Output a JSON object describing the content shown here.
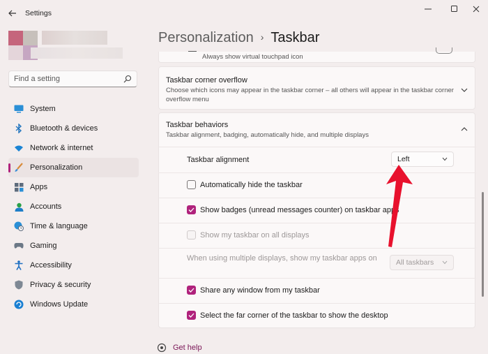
{
  "window": {
    "title": "Settings",
    "back_icon": "back-arrow-icon",
    "controls": [
      "minimize-icon",
      "maximize-icon",
      "close-icon"
    ]
  },
  "search": {
    "placeholder": "Find a setting",
    "icon": "search-icon"
  },
  "sidebar": {
    "items": [
      {
        "label": "System",
        "icon": "monitor-icon",
        "selected": false
      },
      {
        "label": "Bluetooth & devices",
        "icon": "bluetooth-icon",
        "selected": false
      },
      {
        "label": "Network & internet",
        "icon": "wifi-icon",
        "selected": false
      },
      {
        "label": "Personalization",
        "icon": "brush-icon",
        "selected": true
      },
      {
        "label": "Apps",
        "icon": "apps-icon",
        "selected": false
      },
      {
        "label": "Accounts",
        "icon": "person-icon",
        "selected": false
      },
      {
        "label": "Time & language",
        "icon": "globe-clock-icon",
        "selected": false
      },
      {
        "label": "Gaming",
        "icon": "gamepad-icon",
        "selected": false
      },
      {
        "label": "Accessibility",
        "icon": "accessibility-icon",
        "selected": false
      },
      {
        "label": "Privacy & security",
        "icon": "shield-icon",
        "selected": false
      },
      {
        "label": "Windows Update",
        "icon": "update-icon",
        "selected": false
      }
    ]
  },
  "breadcrumb": {
    "parent": "Personalization",
    "separator": "›",
    "current": "Taskbar"
  },
  "touchpad_row": {
    "subtitle": "Always show virtual touchpad icon"
  },
  "corner_overflow": {
    "title": "Taskbar corner overflow",
    "subtitle": "Choose which icons may appear in the taskbar corner – all others will appear in the taskbar corner overflow menu"
  },
  "behaviors": {
    "title": "Taskbar behaviors",
    "subtitle": "Taskbar alignment, badging, automatically hide, and multiple displays",
    "alignment": {
      "label": "Taskbar alignment",
      "value": "Left"
    },
    "options": [
      {
        "label": "Automatically hide the taskbar",
        "checked": false,
        "disabled": false
      },
      {
        "label": "Show badges (unread messages counter) on taskbar apps",
        "checked": true,
        "disabled": false
      },
      {
        "label": "Show my taskbar on all displays",
        "checked": false,
        "disabled": true
      }
    ],
    "multi_display": {
      "label": "When using multiple displays, show my taskbar apps on",
      "value": "All taskbars",
      "disabled": true
    },
    "options2": [
      {
        "label": "Share any window from my taskbar",
        "checked": true,
        "disabled": false
      },
      {
        "label": "Select the far corner of the taskbar to show the desktop",
        "checked": true,
        "disabled": false
      }
    ]
  },
  "help": {
    "label": "Get help",
    "icon": "help-icon"
  },
  "colors": {
    "accent": "#b0227c",
    "annotation_arrow": "#e8112d"
  }
}
